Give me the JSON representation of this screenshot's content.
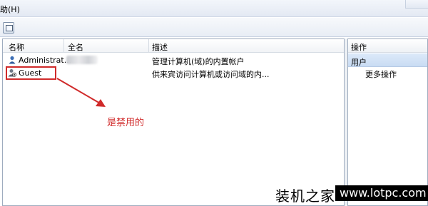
{
  "menu": {
    "help_label": "助(H)"
  },
  "columns": {
    "name": "名称",
    "full_name": "全名",
    "description": "描述"
  },
  "users": [
    {
      "name": "Administrat...",
      "full_name": "",
      "description": "管理计算机(域)的内置帐户"
    },
    {
      "name": "Guest",
      "full_name": "",
      "description": "供来宾访问计算机或访问域的内..."
    }
  ],
  "annotation": {
    "text": "是禁用的",
    "color": "#d02a2a"
  },
  "actions": {
    "title": "操作",
    "users_label": "用户",
    "more_label": "更多操作"
  },
  "watermark": {
    "cn": "装机之家",
    "url": "www.lotpc.com"
  },
  "icons": {
    "toolbar": "window-view-icon",
    "admin": "admin-user-icon",
    "guest": "disabled-user-icon"
  }
}
